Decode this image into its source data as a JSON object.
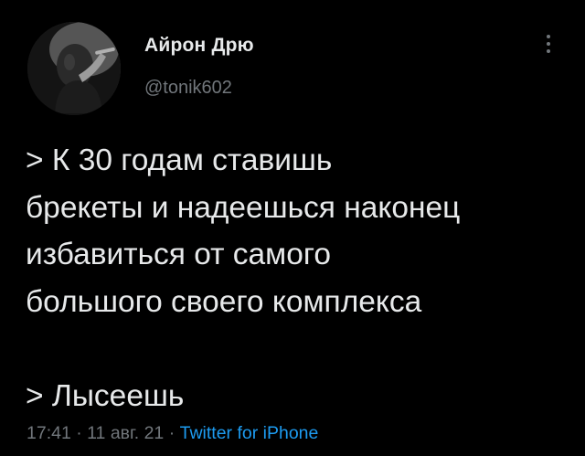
{
  "tweet": {
    "author": {
      "display_name": "Айрон Дрю",
      "handle": "@tonik602",
      "avatar_icon": "user-avatar-photo"
    },
    "more_icon": "more-vertical-icon",
    "text_lines": [
      "> К 30 годам ставишь",
      "брекеты и надеешься наконец",
      "избавиться от самого",
      "большого своего комплекса",
      "> Лысеешь"
    ],
    "meta": {
      "time": "17:41",
      "separator": " · ",
      "date": "11 авг. 21",
      "source": "Twitter for iPhone"
    },
    "colors": {
      "background": "#000000",
      "text": "#e7e9ea",
      "secondary": "#71767b",
      "link": "#1d9bf0"
    }
  }
}
